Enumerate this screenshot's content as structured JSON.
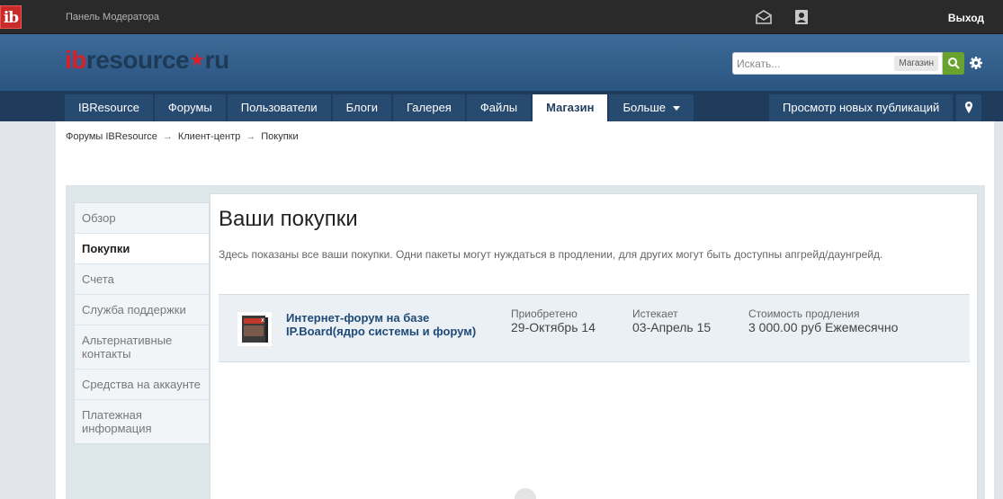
{
  "topbar": {
    "logo_text": "ib",
    "moderator_panel": "Панель Модератора",
    "inbox_icon": "envelope-icon",
    "notifications_icon": "user-badge-icon",
    "logout": "Выход"
  },
  "header": {
    "brand_part1": "ib",
    "brand_part2": "resource",
    "brand_star": "★",
    "brand_part3": "ru",
    "search_placeholder": "Искать...",
    "search_scope": "Магазин"
  },
  "nav": {
    "tabs": [
      {
        "label": "IBResource"
      },
      {
        "label": "Форумы"
      },
      {
        "label": "Пользователи"
      },
      {
        "label": "Блоги"
      },
      {
        "label": "Галерея"
      },
      {
        "label": "Файлы"
      },
      {
        "label": "Магазин",
        "active": true
      },
      {
        "label": "Больше"
      }
    ],
    "new_posts": "Просмотр новых публикаций"
  },
  "breadcrumb": {
    "items": [
      "Форумы IBResource",
      "Клиент-центр",
      "Покупки"
    ],
    "separator": "→"
  },
  "sidebar": {
    "items": [
      {
        "label": "Обзор"
      },
      {
        "label": "Покупки",
        "active": true
      },
      {
        "label": "Счета"
      },
      {
        "label": "Служба поддержки"
      },
      {
        "label": "Альтернативные контакты"
      },
      {
        "label": "Средства на аккаунте"
      },
      {
        "label": "Платежная информация"
      }
    ]
  },
  "main": {
    "title": "Ваши покупки",
    "description": "Здесь показаны все ваши покупки. Одни пакеты могут нуждаться в продлении, для других могут быть доступны апгрейд/даунгрейд.",
    "purchase": {
      "name": "Интернет-форум на базе IP.Board(ядро системы и форум)",
      "purchased_label": "Приобретено",
      "purchased_value": "29-Октябрь 14",
      "expires_label": "Истекает",
      "expires_value": "03-Апрель 15",
      "renewal_label": "Стоимость продления",
      "renewal_value": "3 000.00 руб Ежемесячно"
    }
  },
  "colors": {
    "brand_red": "#d8202a",
    "header_blue": "#2b5582",
    "nav_dark": "#1f3c5c",
    "search_green": "#6aa230",
    "link_blue": "#1f4a78"
  }
}
